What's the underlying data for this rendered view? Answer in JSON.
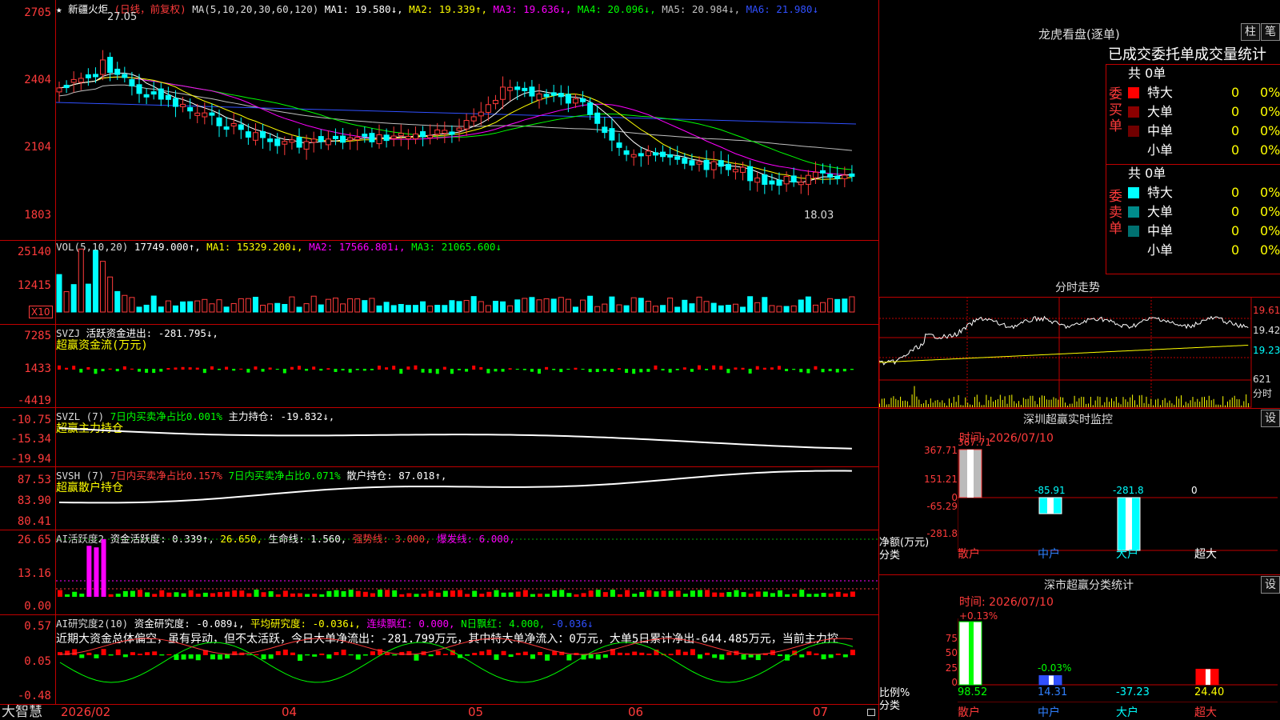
{
  "main": {
    "title_mark": "★",
    "name": "新疆火炬",
    "period": "(日线，前复权)",
    "ma_label": "MA(5,10,20,30,60,120)",
    "ma1": "MA1: 19.580↓,",
    "ma2": "MA2: 19.339↑,",
    "ma3": "MA3: 19.636↓,",
    "ma4": "MA4: 20.096↓,",
    "ma5": "MA5: 20.984↓,",
    "ma6": "MA6: 21.980↓",
    "high_label": "27.05",
    "low_label": "18.03",
    "y_labels": [
      "2705",
      "2404",
      "2104",
      "1803"
    ]
  },
  "vol": {
    "label": "VOL(5,10,20)",
    "value": "17749.000↑,",
    "ma1": "MA1: 15329.200↓,",
    "ma2": "MA2: 17566.801↓,",
    "ma3": "MA3: 21065.600↓",
    "y_labels": [
      "25140",
      "12415"
    ],
    "unit": "X10"
  },
  "svzj": {
    "label": "SVZJ",
    "text": "活跃资金进出: -281.795↓,",
    "subtitle": "超赢资金流(万元)",
    "y_labels": [
      "7285",
      "1433",
      "-4419"
    ]
  },
  "svzl": {
    "label": "SVZL (7)",
    "t1": "7日内买卖净占比0.001%",
    "t2": "主力持仓: -19.832↓,",
    "subtitle": "超赢主力持仓",
    "y_labels": [
      "-10.75",
      "-15.34",
      "-19.94"
    ]
  },
  "svsh": {
    "label": "SVSH (7)",
    "t1": "7日内买卖净占比0.157%",
    "t2": "7日内买卖净占比0.071%",
    "t3": "散户持仓: 87.018↑,",
    "subtitle": "超赢散户持仓",
    "y_labels": [
      "87.53",
      "83.90",
      "80.41"
    ]
  },
  "ai1": {
    "label": "AI活跃度2",
    "t1": "资金活跃度: 0.339↑,",
    "t2": "26.650,",
    "t3": "生命线: 1.560,",
    "t4": "强势线: 3.000,",
    "t5": "爆发线: 6.000,",
    "y_labels": [
      "26.65",
      "13.16",
      "0.00"
    ]
  },
  "ai2": {
    "label": "AI研究度2(10)",
    "t1": "资金研究度: -0.089↓,",
    "t2": "平均研究度: -0.036↓,",
    "t3": "连续飘红: 0.000,",
    "t4": "N日飘红: 4.000,",
    "t5": "-0.036↓",
    "commentary": "近期大资金总体偏空，虽有异动，但不太活跃，今日大单净流出：-281.799万元，其中特大单净流入：0万元，大单5日累计净出-644.485万元，当前主力控",
    "y_labels": [
      "0.57",
      "0.05",
      "-0.48"
    ]
  },
  "bottom": {
    "logo": "大智慧",
    "dates": [
      "2026/02",
      "04",
      "05",
      "06",
      "07"
    ]
  },
  "dragon": {
    "title": "龙虎看盘(逐单)",
    "btn1": "柱",
    "btn2": "笔",
    "header": "已成交委托单成交量统计",
    "buy_label": "委买单",
    "sell_label": "委卖单",
    "buy_total": "共 0单",
    "sell_total": "共 0单",
    "buy_rows": [
      {
        "name": "特大",
        "count": "0",
        "pct": "0%",
        "color": "#ff0000"
      },
      {
        "name": "大单",
        "count": "0",
        "pct": "0%",
        "color": "#8b0000"
      },
      {
        "name": "中单",
        "count": "0",
        "pct": "0%",
        "color": "#700000"
      },
      {
        "name": "小单",
        "count": "0",
        "pct": "0%",
        "color": "#000000"
      }
    ],
    "sell_rows": [
      {
        "name": "特大",
        "count": "0",
        "pct": "0%",
        "color": "#00ffff"
      },
      {
        "name": "大单",
        "count": "0",
        "pct": "0%",
        "color": "#008b8b"
      },
      {
        "name": "中单",
        "count": "0",
        "pct": "0%",
        "color": "#007070"
      },
      {
        "name": "小单",
        "count": "0",
        "pct": "0%",
        "color": "#000000"
      }
    ]
  },
  "intraday": {
    "title": "分时走势",
    "y_labels": [
      "19.61",
      "19.42",
      "19.23"
    ],
    "vol_label": "621",
    "vol_unit": "分时"
  },
  "monitor": {
    "title": "深圳超赢实时监控",
    "btn": "设",
    "time": "时间: 2026/07/10",
    "y_labels": [
      "367.71",
      "151.21",
      "0",
      "-65.29",
      "-281.8"
    ],
    "axis_label1": "净额(万元)",
    "axis_label2": "分类",
    "bars": [
      {
        "label": "散户",
        "value": "367.71"
      },
      {
        "label": "中户",
        "value": "-85.91"
      },
      {
        "label": "大户",
        "value": "-281.8"
      },
      {
        "label": "超大",
        "value": "0"
      }
    ]
  },
  "classify": {
    "title": "深市超赢分类统计",
    "btn": "设",
    "time": "时间: 2026/07/10",
    "y_labels": [
      "75",
      "50",
      "25",
      "0"
    ],
    "axis_label1": "比例%",
    "axis_label2": "分类",
    "top_pct1": "+0.13%",
    "top_pct2": "-0.03%",
    "bars": [
      {
        "label": "散户",
        "value": "98.52"
      },
      {
        "label": "中户",
        "value": "14.31"
      },
      {
        "label": "大户",
        "value": "-37.23"
      },
      {
        "label": "超大",
        "value": "24.40"
      }
    ]
  }
}
